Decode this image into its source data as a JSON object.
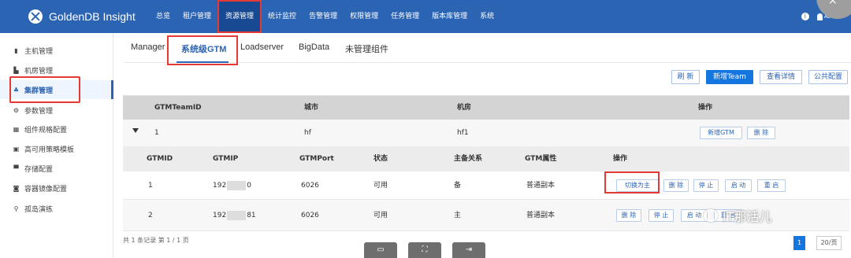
{
  "app": {
    "title": "GoldenDB Insight"
  },
  "nav": [
    "总览",
    "租户管理",
    "资源管理",
    "统计监控",
    "告警管理",
    "权限管理",
    "任务管理",
    "版本库管理",
    "系统"
  ],
  "user": {
    "name": "ADMIN"
  },
  "window": {
    "close_label": "×"
  },
  "sidebar": [
    "主机管理",
    "机房管理",
    "集群管理",
    "参数管理",
    "组件规格配置",
    "高可用策略模板",
    "存储配置",
    "容器镜像配置",
    "孤岛演练"
  ],
  "tabs": [
    "Manager",
    "系统级GTM",
    "Loadserver",
    "BigData",
    "未管理组件"
  ],
  "toolbar": {
    "refresh": "刷 新",
    "new_team": "新增Team",
    "detail": "查看详情",
    "public_config": "公共配置"
  },
  "team_table": {
    "headers": [
      "GTMTeamID",
      "城市",
      "机房",
      "操作"
    ],
    "row": {
      "id": "1",
      "city": "hf",
      "room": "hf1",
      "new_gtm": "新增GTM",
      "delete": "删 除"
    }
  },
  "gtm_table": {
    "headers": [
      "GTMID",
      "GTMIP",
      "GTMPort",
      "状态",
      "主备关系",
      "GTM属性",
      "操作"
    ],
    "rows": [
      {
        "id": "1",
        "ip_prefix": "192",
        "ip_suffix": "0",
        "port": "6026",
        "status": "可用",
        "role": "备",
        "attr": "普通副本",
        "actions": [
          "切换为主",
          "删 除",
          "停 止",
          "启 动",
          "重 启"
        ]
      },
      {
        "id": "2",
        "ip_prefix": "192",
        "ip_suffix": "81",
        "port": "6026",
        "status": "可用",
        "role": "主",
        "attr": "普通副本",
        "actions": [
          "删 除",
          "停 止",
          "启 动",
          "重 启"
        ]
      }
    ]
  },
  "footer": {
    "summary": "共 1 条记录  第 1 / 1 页"
  },
  "pagination": {
    "current": "1",
    "page_size": "20/页"
  },
  "watermark": {
    "text": "IT那活儿"
  }
}
